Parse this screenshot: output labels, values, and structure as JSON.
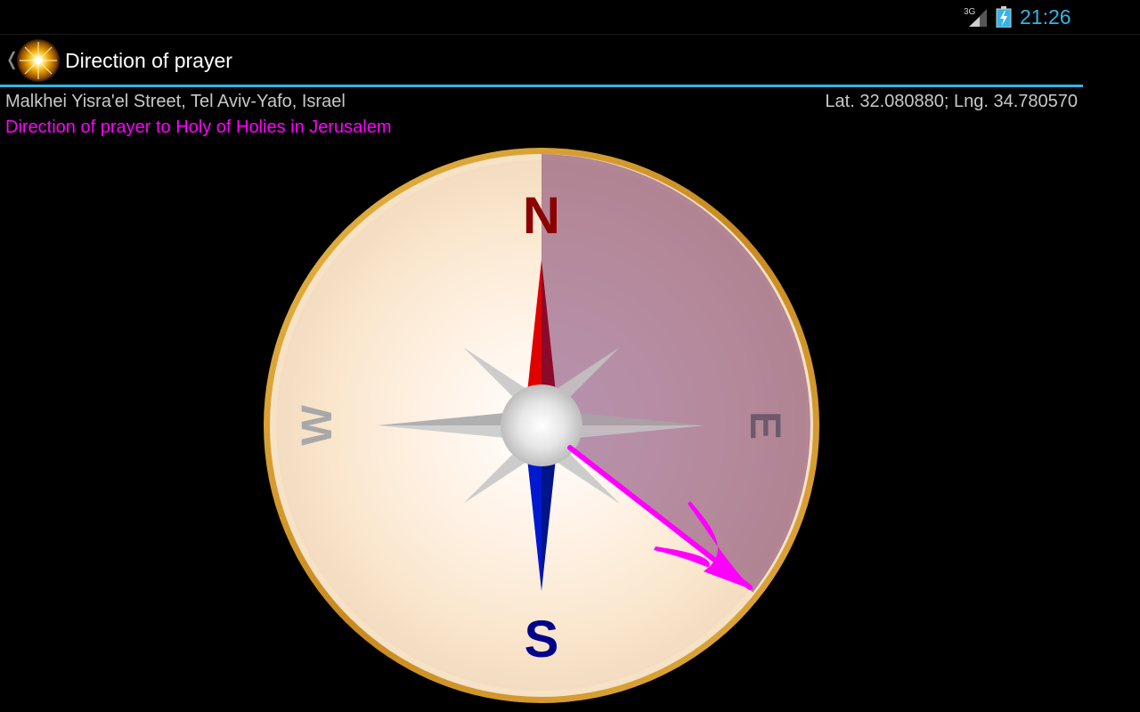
{
  "status_bar": {
    "network": "3G",
    "time": "21:26",
    "icons": [
      "signal-icon",
      "battery-charging-icon"
    ],
    "time_color": "#33b5e5"
  },
  "action_bar": {
    "title": "Direction of prayer",
    "up_glyph": "❬",
    "app_icon": "sun-icon",
    "accent_color": "#33b5e5"
  },
  "location": {
    "address": "Malkhei Yisra'el Street, Tel Aviv-Yafo, Israel",
    "coordinates": "Lat. 32.080880; Lng. 34.780570"
  },
  "prayer": {
    "label": "Direction of prayer to Holy of Holies in Jerusalem",
    "label_color": "#ff00ff"
  },
  "compass": {
    "cardinals": {
      "north": "N",
      "south": "S",
      "east": "E",
      "west": "W"
    },
    "north_color": "#8b0000",
    "south_color": "#00008b",
    "needle_north_color": "#e00000",
    "needle_south_color": "#0018d0",
    "prayer_arrow_color": "#ff00ff",
    "rim_color": "#d4a038"
  }
}
